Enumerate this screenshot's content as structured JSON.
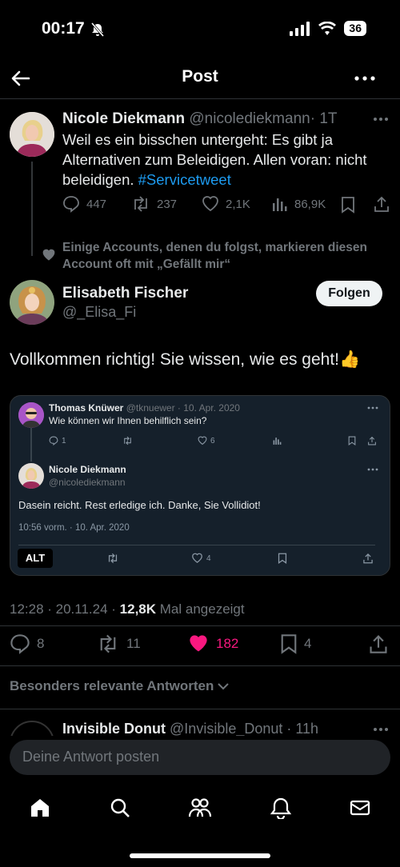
{
  "status": {
    "time": "00:17",
    "battery": "36"
  },
  "header": {
    "title": "Post"
  },
  "parent_tweet": {
    "name": "Nicole Diekmann",
    "handle": "@nicolediekmann",
    "time": "· 1T",
    "text": "Weil es ein bisschen untergeht: Es gibt ja Alternativen zum Beleidigen. Allen voran: nicht beleidigen.",
    "hashtag": "#Servicetweet",
    "replies": "447",
    "retweets": "237",
    "likes": "2,1K",
    "views": "86,9K"
  },
  "social_context": "Einige Accounts, denen du folgst, markieren diesen Account oft mit „Gefällt mir“",
  "main_tweet": {
    "name": "Elisabeth Fischer",
    "handle": "@_Elisa_Fi",
    "follow_label": "Folgen",
    "text": "Vollkommen richtig!  Sie wissen, wie es geht!👍",
    "time": "12:28 · 20.11.24 · ",
    "views_count": "12,8K",
    "views_label": " Mal angezeigt",
    "replies": "8",
    "retweets": "11",
    "likes": "182",
    "bookmarks": "4"
  },
  "quoted": {
    "reply_author": "Thomas Knüwer",
    "reply_handle": "@tknuewer · 10. Apr. 2020",
    "reply_text": "Wie können wir Ihnen behilflich sein?",
    "reply_replies": "1",
    "reply_likes": "6",
    "author": "Nicole Diekmann",
    "handle": "@nicolediekmann",
    "text": "Dasein reicht. Rest erledige ich. Danke, Sie Vollidiot!",
    "timestamp": "10:56 vorm. · 10. Apr. 2020",
    "alt_label": "ALT",
    "likes": "4"
  },
  "replies_section": {
    "sort_label": "Besonders relevante Antworten",
    "next_name": "Invisible Donut",
    "next_handle": "@Invisible_Donut · 11h"
  },
  "reply_box": {
    "placeholder": "Deine Antwort posten"
  },
  "colors": {
    "like": "#f91880",
    "link": "#1d9bf0"
  }
}
